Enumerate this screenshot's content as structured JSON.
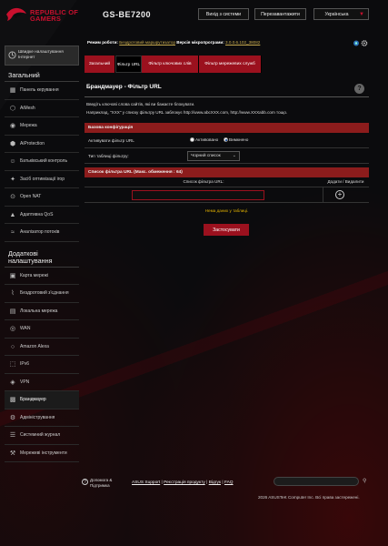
{
  "header": {
    "brand_line1": "REPUBLIC OF",
    "brand_line2": "GAMERS",
    "model": "GS-BE7200",
    "logout_label": "Вихід з системи",
    "reboot_label": "Перезавантажити",
    "language": "Українська"
  },
  "status": {
    "mode_label": "Режим роботи:",
    "mode_value": "Бездротовий маршрутизатор",
    "fw_label": "Версія мікропрограми:",
    "fw_value": "3.0.0.6.102_38082"
  },
  "sidebar": {
    "qis_label": "Швидке налаштування Інтернет",
    "general_title": "Загальний",
    "general_items": [
      {
        "label": "Панель керування",
        "icon": "dashboard-icon"
      },
      {
        "label": "AiMesh",
        "icon": "mesh-icon"
      },
      {
        "label": "Мережа",
        "icon": "network-icon"
      },
      {
        "label": "AiProtection",
        "icon": "shield-icon"
      },
      {
        "label": "Батьківський контроль",
        "icon": "parental-icon"
      },
      {
        "label": "Засіб оптимізації ігор",
        "icon": "gamepad-icon"
      },
      {
        "label": "Open NAT",
        "icon": "open-nat-icon"
      },
      {
        "label": "Адаптивна QoS",
        "icon": "qos-icon"
      },
      {
        "label": "Аналізатор потоків",
        "icon": "traffic-icon"
      }
    ],
    "advanced_title": "Додаткові налаштування",
    "advanced_items": [
      {
        "label": "Карта мережі",
        "icon": "map-icon"
      },
      {
        "label": "Бездротовий з'єднання",
        "icon": "wireless-icon"
      },
      {
        "label": "Локальна мережа",
        "icon": "lan-icon"
      },
      {
        "label": "WAN",
        "icon": "globe-icon"
      },
      {
        "label": "Amazon Alexa",
        "icon": "alexa-icon"
      },
      {
        "label": "IPv6",
        "icon": "ipv6-icon"
      },
      {
        "label": "VPN",
        "icon": "vpn-icon"
      },
      {
        "label": "Брандмауер",
        "icon": "firewall-icon"
      },
      {
        "label": "Адміністрування",
        "icon": "admin-icon"
      },
      {
        "label": "Системний журнал",
        "icon": "log-icon"
      },
      {
        "label": "Мережеві інструменти",
        "icon": "tools-icon"
      }
    ]
  },
  "tabs": [
    "Загальний",
    "Фільтр URL",
    "Фільтр ключових слів",
    "Фільтр мережевих служб"
  ],
  "main": {
    "title": "Брандмауер - Фільтр URL",
    "desc1": "Введіть ключові слова сайтів, які ви бажаєте блокувати.",
    "desc2": "Наприклад, \"XXX\" у списку фільтру URL заблокує http://www.abcXXX.com, http://www.XXXabb.com тощо.",
    "basic_config": "Базова конфігурація",
    "enable_label": "Активувати фільтр URL",
    "opt_on": "Активовано",
    "opt_off": "Вимкнено",
    "table_type_label": "Тип таблиці фільтру:",
    "table_type_value": "Чорний список",
    "list_header": "Список фільтра URL (Макс. обмеження : 64)",
    "col_list": "Список фільтра URL:",
    "col_action": "Додати / Видалити",
    "no_data": "Нема даних у таблиці.",
    "apply_label": "Застосувати",
    "url_input_value": ""
  },
  "footer": {
    "help_line1": "Допомога &",
    "help_line2": "Підтримка",
    "link_support": "ASUS Support",
    "link_register": "Реєстрація продукту",
    "link_feedback": "Відгук",
    "link_faq": "FAQ",
    "sep": "|",
    "copyright": "2026 ASUSTeK Computer Inc. Всі права застережені."
  }
}
